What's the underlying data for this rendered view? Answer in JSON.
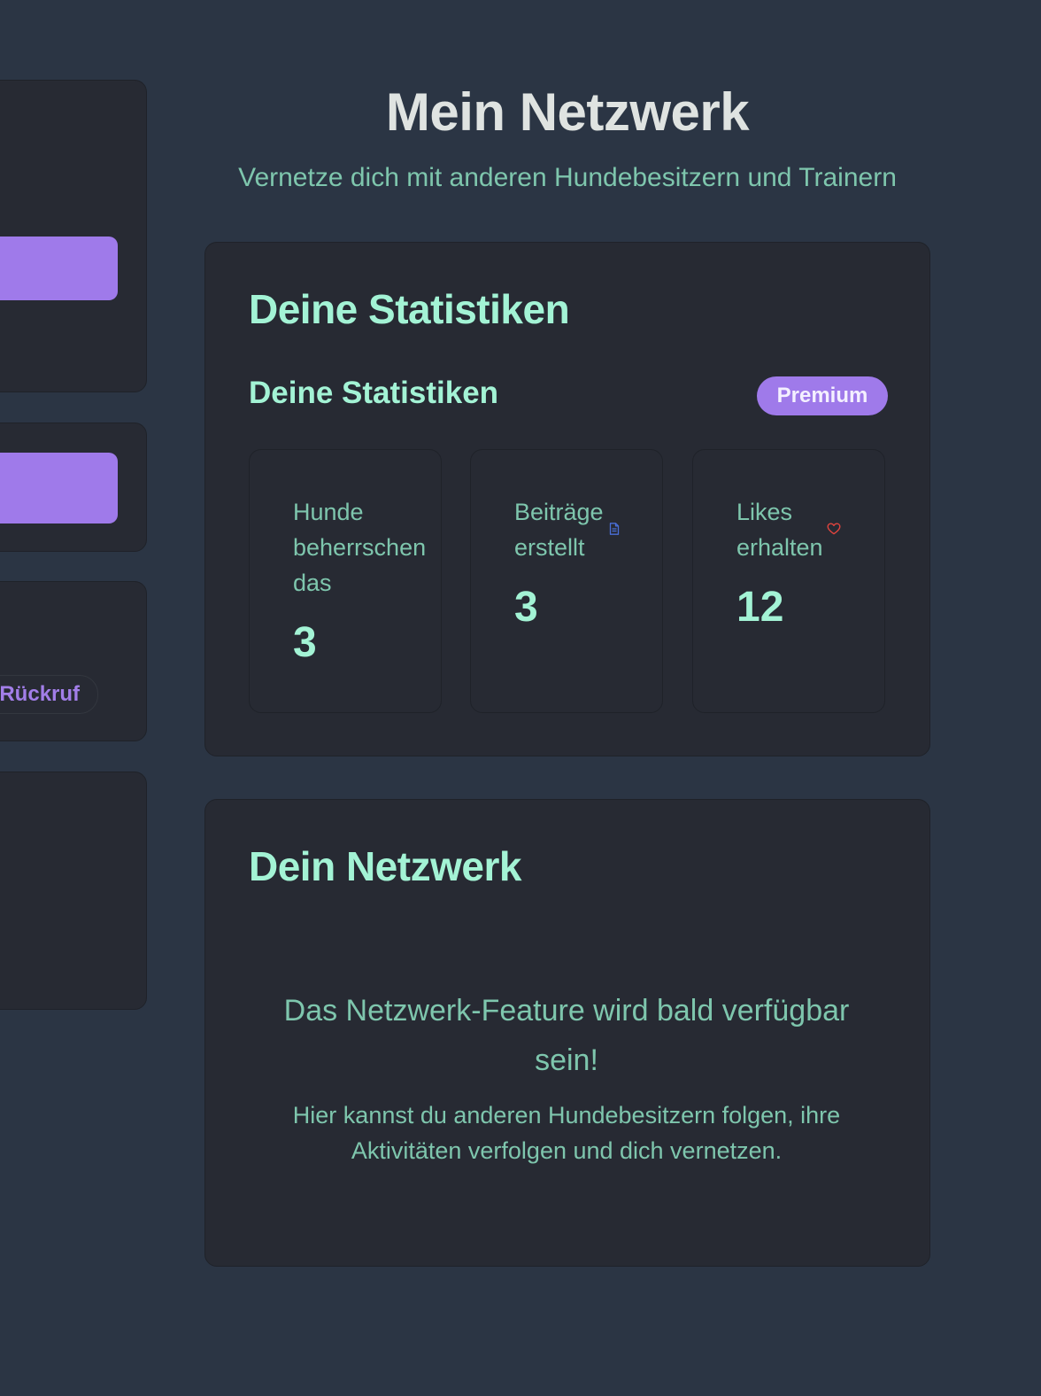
{
  "page": {
    "title": "Mein Netzwerk",
    "subtitle": "Vernetze dich mit anderen Hundebesitzern und Trainern"
  },
  "sidebar": {
    "tag": "#Rückruf"
  },
  "stats_card": {
    "title": "Deine Statistiken",
    "heading": "Deine Statistiken",
    "badge": "Premium",
    "items": [
      {
        "label": "Hunde beherrschen das",
        "value": "3",
        "icon": "none"
      },
      {
        "label": "Beiträge erstellt",
        "value": "3",
        "icon": "document-icon"
      },
      {
        "label": "Likes erhalten",
        "value": "12",
        "icon": "heart-icon"
      }
    ]
  },
  "network_card": {
    "title": "Dein Netzwerk",
    "headline": "Das Netzwerk-Feature wird bald verfügbar sein!",
    "description": "Hier kannst du anderen Hundebesitzern folgen, ihre Aktivitäten verfolgen und dich vernetzen."
  },
  "colors": {
    "background": "#2b3544",
    "card": "#272a33",
    "accent_mint": "#a3f3d5",
    "text_teal": "#7ec6ad",
    "purple": "#9f7aea",
    "icon_blue": "#4a6fd8",
    "icon_red": "#e0443e"
  }
}
